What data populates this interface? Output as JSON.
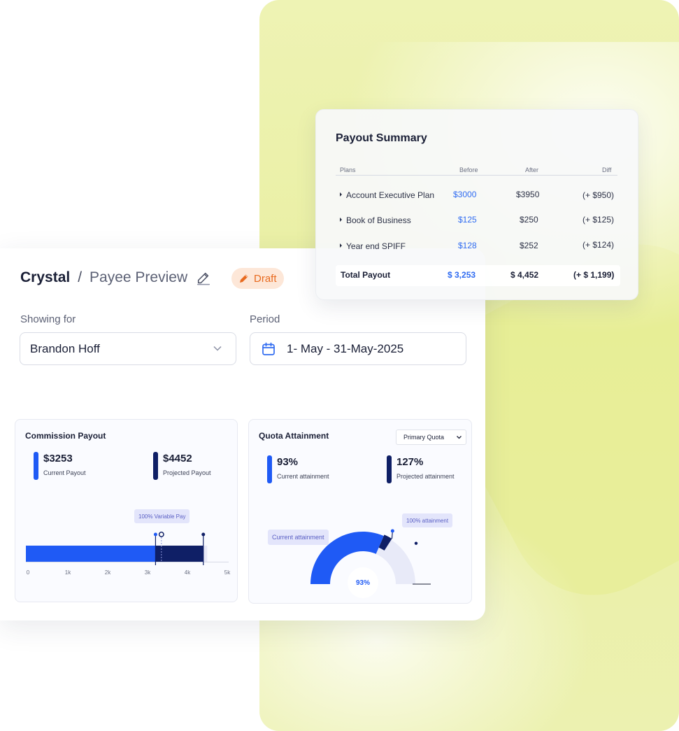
{
  "header": {
    "app_name": "Crystal",
    "separator": "/",
    "page_title": "Payee Preview",
    "status_badge": "Draft"
  },
  "filters": {
    "showing_for_label": "Showing for",
    "showing_for_value": "Brandon Hoff",
    "period_label": "Period",
    "period_value": "1- May - 31-May-2025"
  },
  "commission_payout": {
    "title": "Commission Payout",
    "current_value": "$3253",
    "current_label": "Current Payout",
    "projected_value": "$4452",
    "projected_label": "Projected Payout",
    "marker_label": "100% Variable Pay",
    "axis_ticks": [
      "0",
      "1k",
      "2k",
      "3k",
      "4k",
      "5k"
    ],
    "current_amount": 3253,
    "projected_amount": 4452,
    "variable_pay_marker": 3400,
    "axis_max": 5000,
    "colors": {
      "current": "#1f5af5",
      "projected": "#0f1f66",
      "track": "#e8e9f8"
    }
  },
  "quota_attainment": {
    "title": "Quota Attainment",
    "selector_value": "Primary Quota",
    "current_value": "93%",
    "current_label": "Current attainment",
    "projected_value": "127%",
    "projected_label": "Projected attainment",
    "gauge_center": "93%",
    "tag_current": "Current attainment",
    "tag_target": "100% attainment",
    "current_pct": 93,
    "colors": {
      "current": "#1f5af5",
      "projected": "#0f1f66",
      "track": "#e8eaf8"
    }
  },
  "payout_summary": {
    "title": "Payout Summary",
    "columns": [
      "Plans",
      "Before",
      "After",
      "Diff"
    ],
    "rows": [
      {
        "plan": "Account Executive Plan",
        "before": "$3000",
        "after": "$3950",
        "diff": "(+ $950)"
      },
      {
        "plan": "Book of Business",
        "before": "$125",
        "after": "$250",
        "diff": "(+ $125)"
      },
      {
        "plan": "Year end SPIFF",
        "before": "$128",
        "after": "$252",
        "diff": "(+ $124)"
      }
    ],
    "total": {
      "label": "Total Payout",
      "before": "$ 3,253",
      "after": "$ 4,452",
      "diff": "(+ $ 1,199)"
    }
  }
}
